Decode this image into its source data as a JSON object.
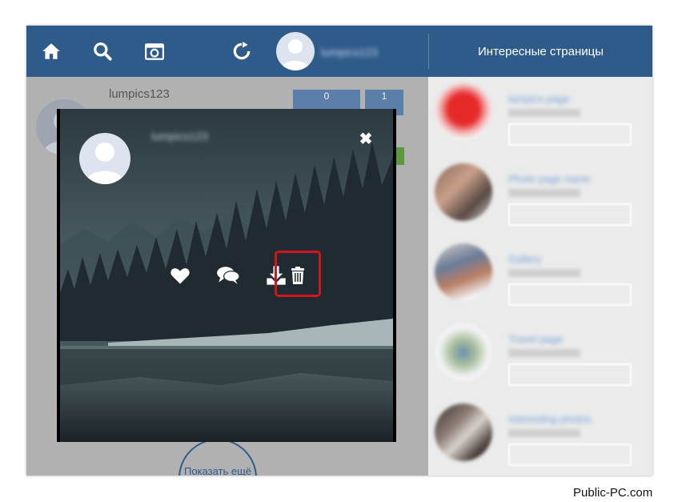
{
  "topbar": {
    "icons": [
      "home-icon",
      "search-icon",
      "camera-icon",
      "refresh-icon"
    ],
    "username_blurred": "lumpics123"
  },
  "sidebar": {
    "title": "Интересные страницы",
    "items": [
      {
        "name": "lumpics page",
        "sub": "subscribers"
      },
      {
        "name": "Photo page name",
        "sub": "subscribers"
      },
      {
        "name": "Gallery",
        "sub": "subscribers"
      },
      {
        "name": "Travel page",
        "sub": "subscribers"
      },
      {
        "name": "Interesting photos",
        "sub": "subscribers"
      }
    ]
  },
  "profile": {
    "name": "lumpics123",
    "stats": [
      "0",
      "1"
    ]
  },
  "main": {
    "show_more": "Показать ещё"
  },
  "modal": {
    "username_blurred": "lumpics123",
    "close": "✖",
    "actions": [
      "like-icon",
      "comments-icon",
      "download-icon",
      "trash-icon"
    ]
  },
  "watermark": "Public-PC.com",
  "colors": {
    "topbar": "#2f5b8a",
    "highlight": "#d5131e",
    "link": "#6f9fd8"
  }
}
